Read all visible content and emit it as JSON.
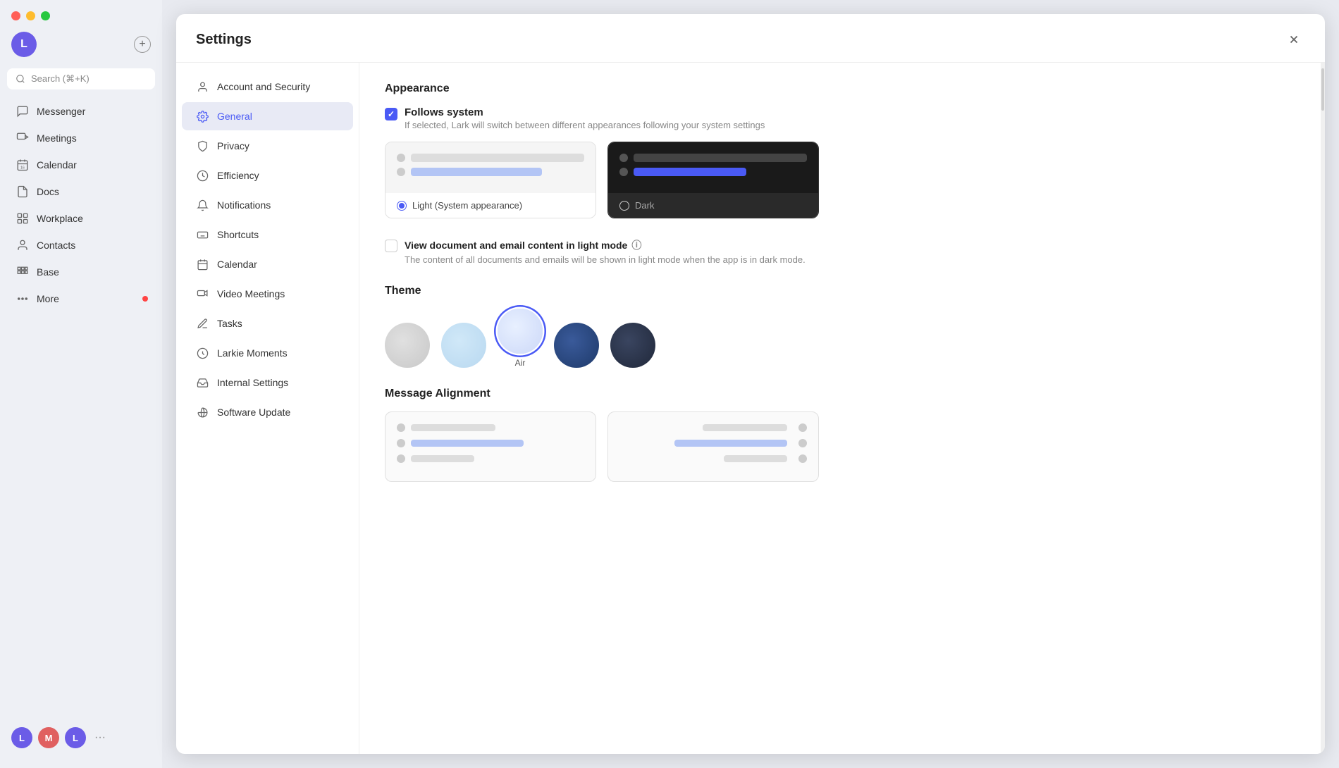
{
  "window_controls": {
    "close": "×",
    "minimize": "−",
    "maximize": "+"
  },
  "sidebar": {
    "avatar_letter": "L",
    "search_label": "Search (⌘+K)",
    "nav_items": [
      {
        "id": "messenger",
        "label": "Messenger",
        "icon": "messenger"
      },
      {
        "id": "meetings",
        "label": "Meetings",
        "icon": "meetings"
      },
      {
        "id": "calendar",
        "label": "Calendar",
        "icon": "calendar"
      },
      {
        "id": "docs",
        "label": "Docs",
        "icon": "docs"
      },
      {
        "id": "workplace",
        "label": "Workplace",
        "icon": "workplace"
      },
      {
        "id": "contacts",
        "label": "Contacts",
        "icon": "contacts"
      },
      {
        "id": "base",
        "label": "Base",
        "icon": "base"
      },
      {
        "id": "more",
        "label": "More",
        "icon": "more",
        "badge": true
      }
    ],
    "bottom_avatars": [
      "L",
      "M",
      "L"
    ],
    "bottom_more": "..."
  },
  "settings": {
    "title": "Settings",
    "close_label": "×",
    "nav_items": [
      {
        "id": "account",
        "label": "Account and Security",
        "icon": "account"
      },
      {
        "id": "general",
        "label": "General",
        "icon": "gear",
        "active": true
      },
      {
        "id": "privacy",
        "label": "Privacy",
        "icon": "privacy"
      },
      {
        "id": "efficiency",
        "label": "Efficiency",
        "icon": "efficiency"
      },
      {
        "id": "notifications",
        "label": "Notifications",
        "icon": "bell"
      },
      {
        "id": "shortcuts",
        "label": "Shortcuts",
        "icon": "keyboard"
      },
      {
        "id": "calendar",
        "label": "Calendar",
        "icon": "calendar"
      },
      {
        "id": "video",
        "label": "Video Meetings",
        "icon": "video"
      },
      {
        "id": "tasks",
        "label": "Tasks",
        "icon": "tasks"
      },
      {
        "id": "larkie",
        "label": "Larkie Moments",
        "icon": "larkie"
      },
      {
        "id": "internal",
        "label": "Internal Settings",
        "icon": "internal"
      },
      {
        "id": "software",
        "label": "Software Update",
        "icon": "software"
      }
    ],
    "content": {
      "appearance_section": "Appearance",
      "follows_system_label": "Follows system",
      "follows_system_desc": "If selected, Lark will switch between different appearances following your system settings",
      "light_label": "Light (System appearance)",
      "dark_label": "Dark",
      "view_doc_label": "View document and email content in light mode",
      "view_doc_desc": "The content of all documents and emails will be shown in light mode when the app is in dark mode.",
      "theme_section": "Theme",
      "theme_selected": "Air",
      "themes": [
        {
          "id": "white",
          "color": "#e8e8e8",
          "label": ""
        },
        {
          "id": "light-blue",
          "color": "#c8dff0",
          "label": ""
        },
        {
          "id": "air",
          "color": "#dde8f8",
          "label": "Air",
          "selected": true
        },
        {
          "id": "dark-blue",
          "color": "#2d4a7a",
          "label": ""
        },
        {
          "id": "deep-dark",
          "color": "#2a3550",
          "label": ""
        }
      ],
      "message_align_section": "Message Alignment"
    }
  }
}
